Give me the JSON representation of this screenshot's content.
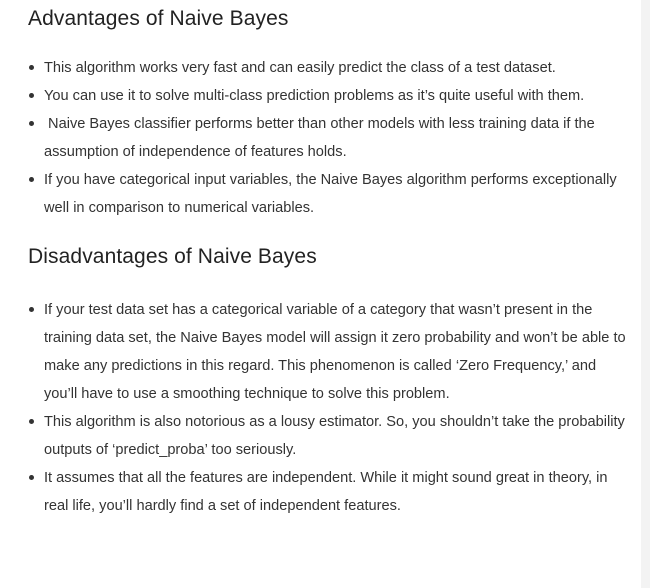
{
  "advantages": {
    "heading": "Advantages of Naive Bayes",
    "items": [
      "This algorithm works very fast and can easily predict the class of a test dataset.",
      "You can use it to solve multi-class prediction problems as it’s quite useful with them.",
      " Naive Bayes classifier performs better than other models with less training data if the assumption of independence of features holds.",
      "If you have categorical input variables, the Naive Bayes algorithm performs exceptionally well in comparison to numerical variables."
    ]
  },
  "disadvantages": {
    "heading": "Disadvantages of Naive Bayes",
    "items": [
      "If your test data set has a categorical variable of a category that wasn’t present in the training data set, the Naive Bayes model will assign it zero probability and won’t be able to make any predictions in this regard. This phenomenon is called ‘Zero Frequency,’ and you’ll have to use a smoothing technique to solve this problem.",
      "This algorithm is also notorious as a lousy estimator. So, you shouldn’t take the probability outputs of ‘predict_proba’ too seriously.",
      "It assumes that all the features are independent. While it might sound great in theory, in real life, you’ll hardly find a set of independent features."
    ]
  }
}
